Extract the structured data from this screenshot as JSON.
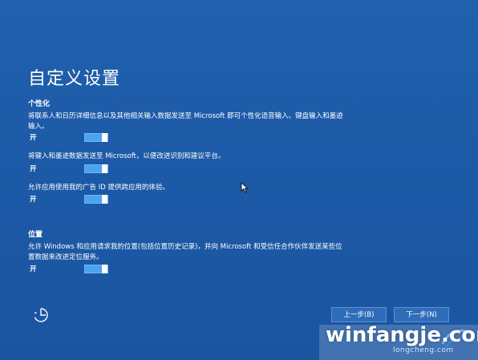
{
  "page": {
    "title": "自定义设置"
  },
  "personalization": {
    "heading": "个性化",
    "settings": [
      {
        "description": "将联系人和日历详细信息以及其他相关输入数据发送至 Microsoft 即可个性化语音输入、键盘输入和墨迹输入。",
        "state_label": "开",
        "on": true
      },
      {
        "description": "将键入和墨迹数据发送至 Microsoft，以便改进识别和建议平台。",
        "state_label": "开",
        "on": true
      },
      {
        "description": "允许应用使用我的广告 ID 提供跨应用的体验。",
        "state_label": "开",
        "on": true
      }
    ]
  },
  "location": {
    "heading": "位置",
    "settings": [
      {
        "description": "允许 Windows 和应用请求我的位置(包括位置历史记录)，并向 Microsoft 和受信任合作伙伴发送某些位置数据来改进定位服务。",
        "state_label": "开",
        "on": true
      }
    ]
  },
  "footer": {
    "ease_of_access_icon": "ease-of-access-icon",
    "back_label": "上一步(B)",
    "next_label": "下一步(N)"
  },
  "watermark": {
    "text": "winfangje.com",
    "sub": "longcheng.com"
  },
  "colors": {
    "background": "#1f5ba8",
    "toggle_on": "#4ea3f1",
    "text": "#ffffff"
  }
}
